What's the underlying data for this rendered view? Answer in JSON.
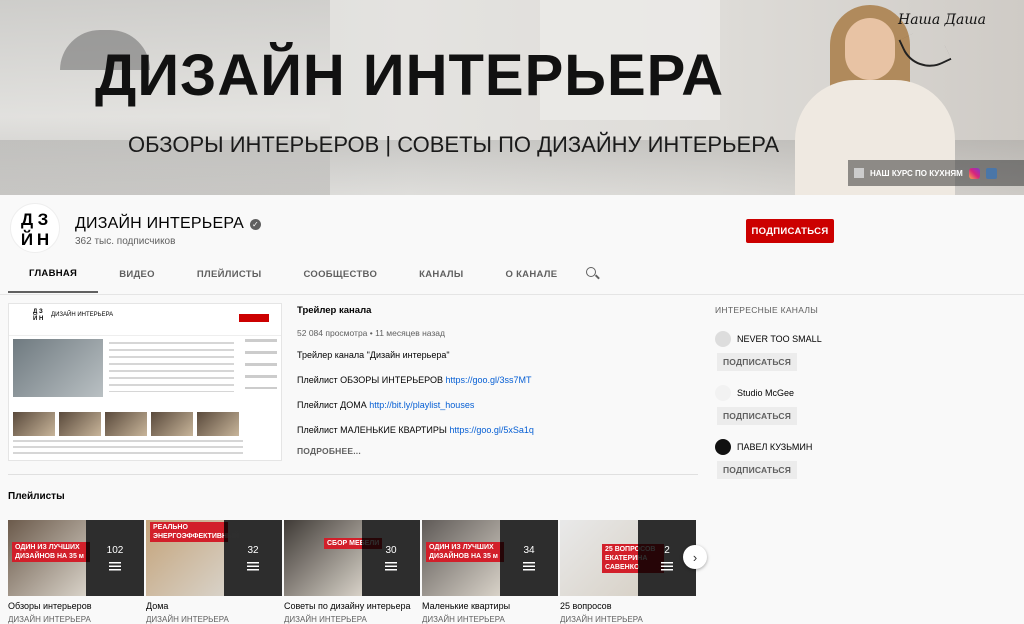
{
  "banner": {
    "title": "ДИЗАЙН ИНТЕРЬЕРА",
    "subtitle": "ОБЗОРЫ ИНТЕРЬЕРОВ | СОВЕТЫ ПО ДИЗАЙНУ ИНТЕРЬЕРА",
    "note": "Наша Даша",
    "link_label": "НАШ КУРС ПО КУХНЯМ"
  },
  "channel": {
    "avatar_letters": [
      "Д",
      "З",
      "Й",
      "Н"
    ],
    "name": "ДИЗАЙН ИНТЕРЬЕРА",
    "subscribers": "362 тыс. подписчиков",
    "subscribe_label": "ПОДПИСАТЬСЯ"
  },
  "tabs": [
    "ГЛАВНАЯ",
    "ВИДЕО",
    "ПЛЕЙЛИСТЫ",
    "СООБЩЕСТВО",
    "КАНАЛЫ",
    "О КАНАЛЕ"
  ],
  "trailer": {
    "mini_channel": "ДИЗАЙН ИНТЕРЬЕРА",
    "title": "Трейлер канала",
    "meta": "52 084 просмотра • 11 месяцев назад",
    "description": "Трейлер канала \"Дизайн интерьера\"",
    "links": [
      {
        "label": "Плейлист ОБЗОРЫ ИНТЕРЬЕРОВ ",
        "url": "https://goo.gl/3ss7MT"
      },
      {
        "label": "Плейлист ДОМА ",
        "url": "http://bit.ly/playlist_houses"
      },
      {
        "label": "Плейлист МАЛЕНЬКИЕ КВАРТИРЫ ",
        "url": "https://goo.gl/5xSa1q"
      }
    ],
    "more": "ПОДРОБНЕЕ..."
  },
  "featured": {
    "heading": "ИНТЕРЕСНЫЕ КАНАЛЫ",
    "channels": [
      {
        "name": "NEVER TOO SMALL",
        "button": "ПОДПИСАТЬСЯ"
      },
      {
        "name": "Studio McGee",
        "button": "ПОДПИСАТЬСЯ"
      },
      {
        "name": "ПАВЕЛ КУЗЬМИН",
        "button": "ПОДПИСАТЬСЯ"
      }
    ]
  },
  "playlists": {
    "heading": "Плейлисты",
    "items": [
      {
        "name": "Обзоры интерьеров",
        "count": "102",
        "owner": "ДИЗАЙН ИНТЕРЬЕРА",
        "tag": "ОДИН ИЗ ЛУЧШИХ ДИЗАЙНОВ НА 35 м",
        "color": "#6b5a4b"
      },
      {
        "name": "Дома",
        "count": "32",
        "owner": "ДИЗАЙН ИНТЕРЬЕРА",
        "tag": "РЕАЛЬНО ЭНЕРГОЭФФЕКТИВНЫЙ",
        "color": "#c4a37a"
      },
      {
        "name": "Советы по дизайну интерьера",
        "count": "30",
        "owner": "ДИЗАЙН ИНТЕРЬЕРА",
        "tag": "СБОР МЕБЕЛИ",
        "color": "#3f3a36"
      },
      {
        "name": "Маленькие квартиры",
        "count": "34",
        "owner": "ДИЗАЙН ИНТЕРЬЕРА",
        "tag": "ОДИН ИЗ ЛУЧШИХ ДИЗАЙНОВ НА 35 м",
        "color": "#5f5a57"
      },
      {
        "name": "25 вопросов",
        "count": "2",
        "owner": "ДИЗАЙН ИНТЕРЬЕРА",
        "tag": "25 ВОПРОСОВ ЕКАТЕРИНА САВЕНКО",
        "color": "#e9e9e9"
      }
    ]
  },
  "colors": {
    "subscribe": "#cc0000",
    "link": "#065fd4"
  }
}
